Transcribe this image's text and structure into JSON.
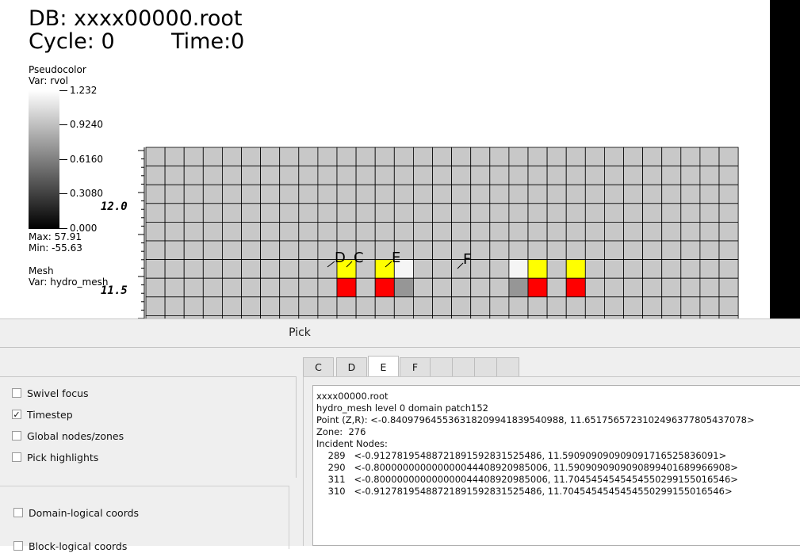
{
  "viz": {
    "db_title": "DB: xxxx00000.root",
    "cycle": "Cycle: 0",
    "time": "Time:0",
    "pseudocolor_label": "Pseudocolor",
    "pseudocolor_var": "Var: rvol",
    "colorbar_ticks": [
      "1.232",
      "0.9240",
      "0.6160",
      "0.3080",
      "0.000"
    ],
    "max_label": "Max:  57.91",
    "min_label": "Min:  -55.63",
    "mesh_label": "Mesh",
    "mesh_var": "Var: hydro_mesh",
    "axis_ticks": [
      "12.0",
      "11.5"
    ],
    "pick_letters": [
      "D",
      "C",
      "E",
      "F"
    ],
    "colors": {
      "cell_gray": "#c8c8c8",
      "yellow": "#ffff00",
      "red": "#ff0000",
      "dark_gray": "#969696",
      "white_cell": "#f5f5f5",
      "grid_line": "#000000"
    }
  },
  "pick": {
    "title": "Pick",
    "tabs": [
      "C",
      "D",
      "E",
      "F",
      "",
      "",
      "",
      ""
    ],
    "active_tab": "E",
    "options_top": [
      {
        "label": "Swivel focus",
        "checked": false
      },
      {
        "label": "Timestep",
        "checked": true
      },
      {
        "label": "Global nodes/zones",
        "checked": false
      },
      {
        "label": "Pick highlights",
        "checked": false
      }
    ],
    "options_bottom": [
      {
        "label": "Domain-logical coords",
        "checked": false
      },
      {
        "label": "Block-logical coords",
        "checked": false
      }
    ],
    "result_lines": [
      "xxxx00000.root",
      "hydro_mesh level 0 domain patch152",
      "Point (Z,R): <-0.84097964553631820994183954098​8, 11.651756572310249637780543707​8>",
      "Zone:  276",
      "Incident Nodes:",
      "    289   <-0.912781954887218915928315254​86, 11.590909090909091716525836091>",
      "    290   <-0.800000000000000044408920985006, 11.590909090909089940168996690​8>",
      "    311   <-0.800000000000000044408920985006, 11.704545454545455029915501654​6>",
      "    310   <-0.912781954887218915928315254​86, 11.704545454545455029915501654​6>"
    ]
  }
}
